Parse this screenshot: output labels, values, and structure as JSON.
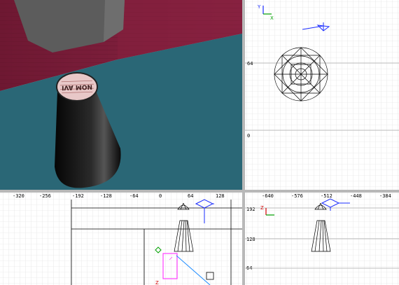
{
  "colors": {
    "floor": "#2a6776",
    "wall": "#7a1e38",
    "object": "#101010",
    "grid_minor": "#e0e0e0",
    "grid_major": "#a8a8a8",
    "wireframe": "#000000",
    "light": "#1a2cff",
    "axis_x": "#00a000",
    "axis_y": "#1a2cff",
    "axis_z": "#d00000",
    "selection": "#ff40ff"
  },
  "camera_view": {
    "label_text": "NOM AVI"
  },
  "top_view": {
    "axes": {
      "y": "Y",
      "x": "X"
    },
    "ticks": [
      "64",
      "0"
    ]
  },
  "front_view": {
    "ticks": [
      "-320",
      "-256",
      "-192",
      "-128",
      "-64",
      "0",
      "64",
      "128"
    ],
    "axis_z": "Z"
  },
  "side_view": {
    "ticks_x": [
      "-640",
      "-576",
      "-512",
      "-448",
      "-384"
    ],
    "ticks_y": [
      "192",
      "128",
      "64"
    ],
    "axis_z": "Z"
  }
}
